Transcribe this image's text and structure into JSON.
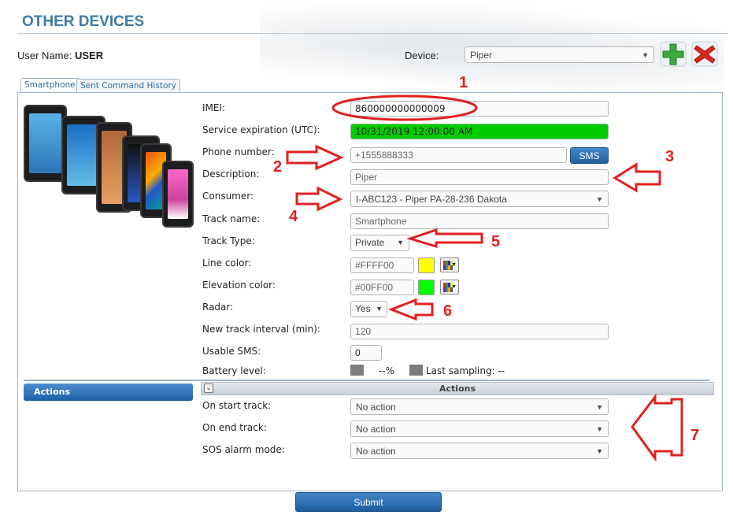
{
  "header": {
    "title": "OTHER DEVICES",
    "user_label_prefix": "User Name:",
    "user_name": "USER",
    "device_label": "Device:",
    "device_value": "Piper"
  },
  "tabs": [
    {
      "label": "Smartphone",
      "active": true
    },
    {
      "label": "Sent Command History",
      "active": false
    }
  ],
  "form": {
    "imei_label": "IMEI:",
    "imei_value": "860000000000009",
    "service_expiration_label": "Service expiration (UTC):",
    "service_expiration_value": "10/31/2019 12:00:00 AM",
    "phone_label": "Phone number:",
    "phone_value": "+1555888333",
    "sms_button": "SMS",
    "description_label": "Description:",
    "description_value": "Piper",
    "consumer_label": "Consumer:",
    "consumer_value": "I-ABC123 - Piper PA-28-236 Dakota",
    "track_name_label": "Track name:",
    "track_name_value": "Smartphone",
    "track_type_label": "Track Type:",
    "track_type_value": "Private",
    "line_color_label": "Line color:",
    "line_color_value": "#FFFF00",
    "elevation_color_label": "Elevation color:",
    "elevation_color_value": "#00FF00",
    "radar_label": "Radar:",
    "radar_value": "Yes",
    "new_track_interval_label": "New track interval (min):",
    "new_track_interval_value": "120",
    "usable_sms_label": "Usable SMS:",
    "usable_sms_value": "0",
    "battery_label": "Battery level:",
    "battery_value": "--%",
    "last_sampling_label": "Last sampling: --"
  },
  "actions": {
    "sidebar_label": "Actions",
    "section_title": "Actions",
    "on_start_label": "On start track:",
    "on_start_value": "No action",
    "on_end_label": "On end track:",
    "on_end_value": "No action",
    "sos_label": "SOS alarm mode:",
    "sos_value": "No action"
  },
  "submit_label": "Submit",
  "annotations": {
    "a1": "1",
    "a2": "2",
    "a3": "3",
    "a4": "4",
    "a5": "5",
    "a6": "6",
    "a7": "7"
  },
  "colors": {
    "title": "#3e7aa5",
    "accent_blue": "#2a6db0",
    "expiration_green": "#00cc00",
    "line_color_swatch": "#ffff00",
    "elevation_color_swatch": "#00ff00",
    "annotation_red": "#e02020"
  },
  "icons": [
    "plus-icon",
    "delete-x-icon",
    "collapse-icon",
    "color-palette-icon",
    "dropdown-arrow-icon"
  ]
}
